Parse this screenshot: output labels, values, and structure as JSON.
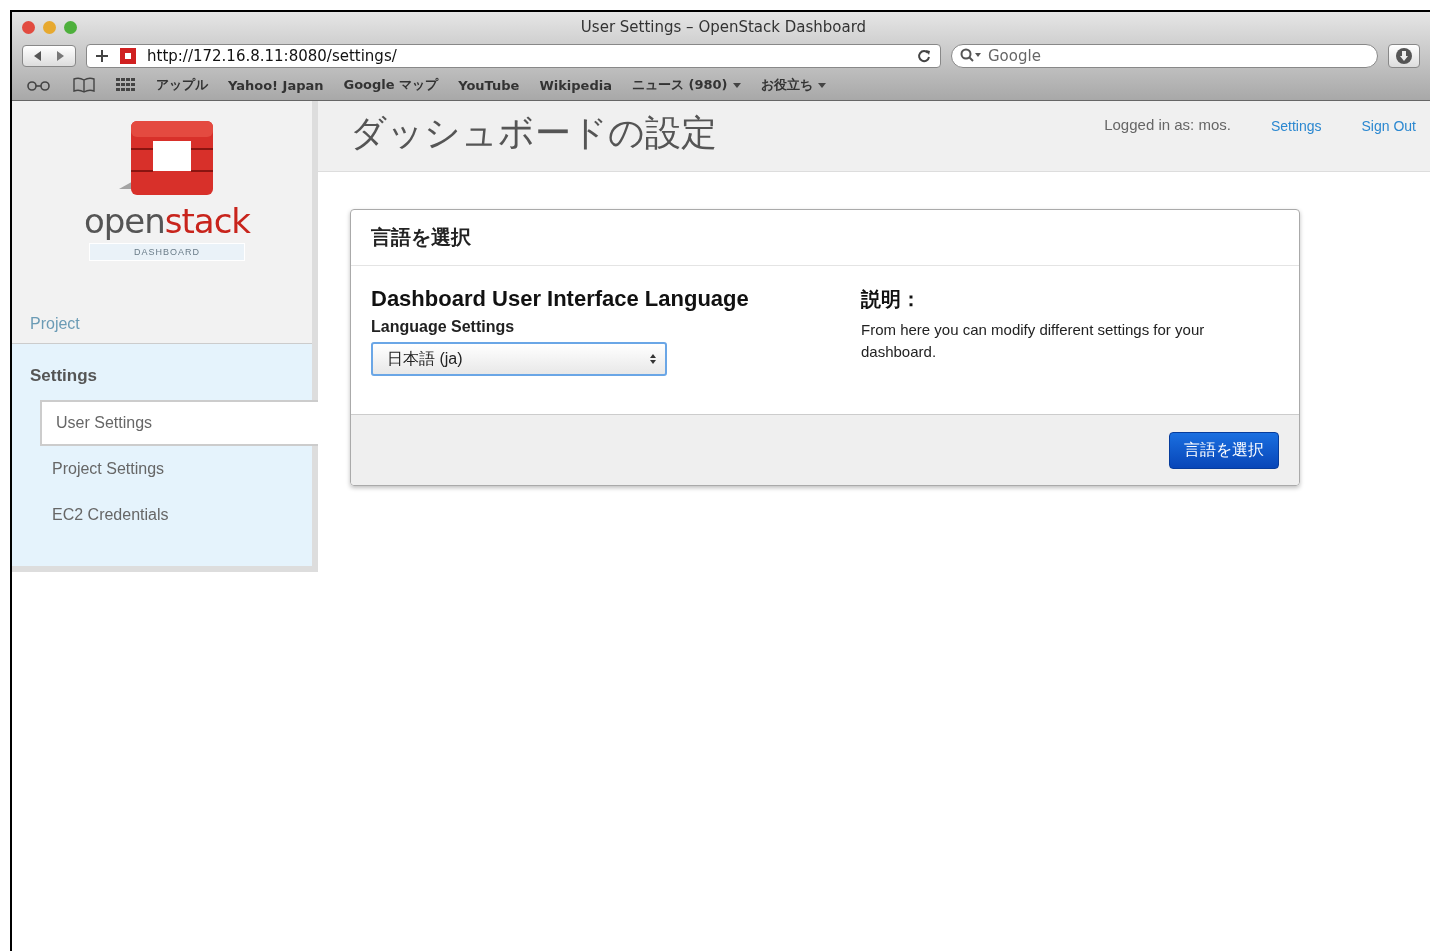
{
  "window": {
    "title": "User Settings – OpenStack Dashboard"
  },
  "address_bar": {
    "value": "http://172.16.8.11:8080/settings/"
  },
  "search": {
    "placeholder": "Google"
  },
  "bookmarks": [
    {
      "label": "アップル",
      "has_menu": false
    },
    {
      "label": "Yahoo! Japan",
      "has_menu": false
    },
    {
      "label": "Google マップ",
      "has_menu": false
    },
    {
      "label": "YouTube",
      "has_menu": false
    },
    {
      "label": "Wikipedia",
      "has_menu": false
    },
    {
      "label": "ニュース (980)",
      "has_menu": true
    },
    {
      "label": "お役立ち",
      "has_menu": true
    }
  ],
  "logo": {
    "word_part_1": "open",
    "word_part_2": "stack",
    "subtitle": "DASHBOARD"
  },
  "sidebar": {
    "items": [
      {
        "label": "Project",
        "selected": false
      },
      {
        "label": "Settings",
        "selected": true,
        "children": [
          {
            "label": "User Settings",
            "selected": true
          },
          {
            "label": "Project Settings",
            "selected": false
          },
          {
            "label": "EC2 Credentials",
            "selected": false
          }
        ]
      }
    ]
  },
  "header": {
    "title": "ダッシュボードの設定",
    "user": "Logged in as: mos.",
    "links": [
      "Settings",
      "Sign Out"
    ]
  },
  "panel": {
    "title": "言語を選択",
    "section_title": "Dashboard User Interface Language",
    "field_label": "Language Settings",
    "select_value": "日本語 (ja)",
    "help_title": "説明：",
    "help_text": "From here you can modify different settings for your dashboard.",
    "submit": "言語を選択"
  }
}
